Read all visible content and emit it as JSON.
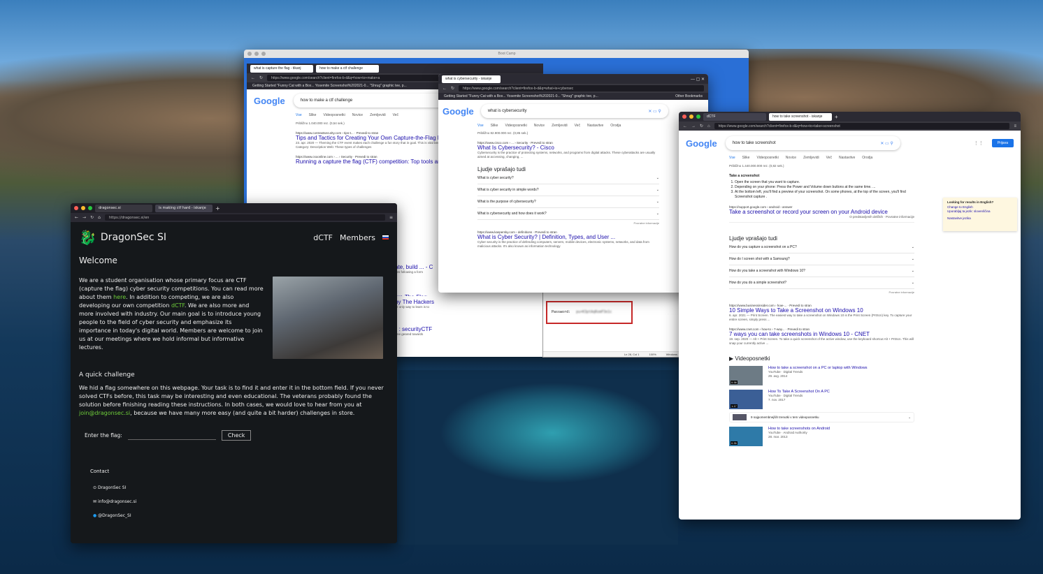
{
  "win_back": {
    "title": "Boot Camp",
    "tabs": [
      "what is capture the flag - tikanj",
      "how to make a ctf challenge"
    ],
    "url": "https://www.google.com/search?client=firefox-b-d&q=how+to+make+a",
    "bookmarks": "Getting Started   \"Funny Cat with a Box...   Yosemite   Screenshot%202021-0...   \"Shrug\" graphic tee, p...",
    "query": "how to make a ctf challenge",
    "tabs_google": [
      "Vse",
      "Slike",
      "Videoposnetki",
      "Novice",
      "Zemljevidi",
      "Več"
    ],
    "stats": "Približno 1.040.000 rez. (0,54 sek.)",
    "r1_cite": "https://www.contrastsecurity.com › tips-t... · Prevedi to stran",
    "r1_title": "Tips and Tactics for Creating Your Own Capture-the-Flag E",
    "r1_desc": "23. apr. 2020 — Theming the CTF event makes each challenge a fun story that in goal. This is vital because good CTF challenges tell a story. They give ...",
    "r1_extra": "Category: Description        Web: These types of challenges",
    "r2_cite": "https://www.csoonline.com › ... › Security · Prevedi to stran",
    "r2_title": "Running a capture the flag (CTF) competition: Top tools an",
    "frag1": "reate, build ... - C",
    "frag2": "llenges following a form",
    "frag3": "pture-The-Flag",
    "frag4": "ince · Selecting CTF Ca",
    "frag5": "ir Challenges",
    "frag6": "F) | by The Hackers",
    "frag7": "have, the only way to learn is to",
    "frag8": "allenges",
    "frag9": "ges? : securityCTF",
    "frag10": "-ups online geared towards",
    "frag11": "wever"
  },
  "win_cyber": {
    "tab": "what is cybersecurity - iskanje",
    "url": "https://www.google.com/search?client=firefox-b-d&q=what+is+cybersec",
    "bookmarks": "Getting Started   \"Funny Cat with a Box...   Yosemite   Screenshot%202021-0...   \"Shrug\" graphic tee, p...",
    "other_bm": "Other Bookmarks",
    "query": "what is cybersecurity",
    "tabs_google": [
      "Vse",
      "Slike",
      "Videoposnetki",
      "Novice",
      "Zemljevidi",
      "Več",
      "Nastavitve",
      "Orodja"
    ],
    "stats": "Približno 82.900.000 rez. (0,85 sek.)",
    "r1_cite": "https://www.cisco.com › ... › Security · Prevedi to stran",
    "r1_title": "What Is Cybersecurity? - Cisco",
    "r1_desc": "Cybersecurity is the practice of protecting systems, networks, and programs from digital attacks. These cyberattacks are usually aimed at accessing, changing, ...",
    "paa_title": "Ljudje vprašajo tudi",
    "paa": [
      "What is cyber security?",
      "What is cyber security in simple words?",
      "What is the purpose of cybersecurity?",
      "What is cybersecurity and how does it work?"
    ],
    "feedback": "Povratne informacije",
    "r2_cite": "https://www.kaspersky.com › definitions · Prevedi to stran",
    "r2_title": "What is Cyber Security? | Definition, Types, and User ...",
    "r2_desc": "Cyber security is the practice of defending computers, servers, mobile devices, electronic systems, networks, and data from malicious attacks. It's also known as information technology"
  },
  "notepad": {
    "label": "Password:",
    "value": "pu+K3ptAqRomF3e1c",
    "status_pos": "Ln 28, Col 1",
    "status_zoom": "100%",
    "status_enc": "Windows"
  },
  "win_shot": {
    "tabs": [
      "dCTF",
      "how to take screenshot - iskanje"
    ],
    "url": "https://www.google.com/search?client=firefox-b-d&q=how+to+take+screenshot",
    "query": "how to take screenshot",
    "signin": "Prijava",
    "tabs_google": [
      "Vse",
      "Slike",
      "Videoposnetki",
      "Novice",
      "Zemljevidi",
      "Več",
      "Nastavitve",
      "Orodja"
    ],
    "stats": "Približno 1.440.000.000 rez. (0,82 sek.)",
    "snippet_title": "Take a screenshot",
    "steps": [
      "Open the screen that you want to capture.",
      "Depending on your phone: Press the Power and Volume down buttons at the same time. ...",
      "At the bottom left, you'll find a preview of your screenshot. On some phones, at the top of the screen, you'll find Screenshot capture ."
    ],
    "s_cite": "https://support.google.com › android › answer",
    "s_title": "Take a screenshot or record your screen on your Android device",
    "s_about": "O predstavljenih delčkih",
    "feedback": "Povratne informacije",
    "paa_title": "Ljudje vprašajo tudi",
    "paa": [
      "How do you capture a screenshot on a PC?",
      "How do I screen shot with a Samsung?",
      "How do you take a screenshot with Windows 10?",
      "How do you do a simple screenshot?"
    ],
    "r1_cite": "https://www.businessinsider.com › how-... · Prevedi to stran",
    "r1_title": "10 Simple Ways to Take a Screenshot on Windows 10",
    "r1_desc": "6. apr. 2021 — Print Screen. The easiest way to take a screenshot on Windows 10 is the Print Screen (PrtScn) key. To capture your entire screen, simply press ...",
    "r2_cite": "https://www.cnet.com › how-to › 7-way... · Prevedi to stran",
    "r2_title": "7 ways you can take screenshots in Windows 10 - CNET",
    "r2_desc": "19. sep. 2020 — Alt + Print Screen. To take a quick screenshot of the active window, use the keyboard shortcut Alt + PrtScn. This will snap your currently active ...",
    "video_title": "Videoposnetki",
    "videos": [
      {
        "title": "How to take a screenshot on a PC or laptop with Windows",
        "src": "YouTube · Digital Trends",
        "date": "29. avg. 2014",
        "dur": "0:38"
      },
      {
        "title": "How To Take A Screenshot On A PC",
        "src": "YouTube · Digital Trends",
        "date": "7. nov. 2017",
        "dur": "1:17"
      },
      {
        "title": "How to take screenshots on Android",
        "src": "YouTube · Android Authority",
        "date": "28. mar. 2013",
        "dur": "0:35"
      }
    ],
    "moments": "9 najpomembnejših trenutki v tem videoposnetku",
    "lang_title": "Looking for results in English?",
    "lang_1": "Change to English",
    "lang_2": "Uporabljaj ta jezik: slovenščina",
    "lang_3": "Nastavitve jezika"
  },
  "dragonsec": {
    "tabs": [
      "dragonsec.si",
      "is making ctf hard - iskanje"
    ],
    "url": "https://dragonsec.si/en",
    "brand": "DragonSec SI",
    "nav_dctf": "dCTF",
    "nav_members": "Members",
    "welcome": "Welcome",
    "p1a": "We are a student organisation whose primary focus are CTF (capture the flag) cyber security competitions. You can read more about them ",
    "p1_here": "here",
    "p1b": ". In addition to competing, we are also developing our own competition ",
    "p1_dctf": "dCTF",
    "p1c": ". We are also more and more involved with industry. Our main goal is to introduce young people to the field of cyber security and emphasize its importance in today's digital world. Members are welcome to join us at our meetings where we hold informal but informative lectures.",
    "challenge_title": "A quick challenge",
    "p2a": "We hid a flag somewhere on this webpage. Your task is to find it and enter it in the bottom field. If you never solved CTFs before, this task may be interesting and even educational. The veterans probably found the solution before finishing reading these instructions. In both cases, we would love to hear from you at ",
    "p2_mail": "join@dragonsec.si",
    "p2b": ", because we have many more easy (and quite a bit harder) challenges in store.",
    "flag_label": "Enter the flag:",
    "check": "Check",
    "contact": "Contact",
    "github": "DragonSec SI",
    "email": "info@dragonsec.si",
    "twitter": "@DragonSec_SI"
  }
}
